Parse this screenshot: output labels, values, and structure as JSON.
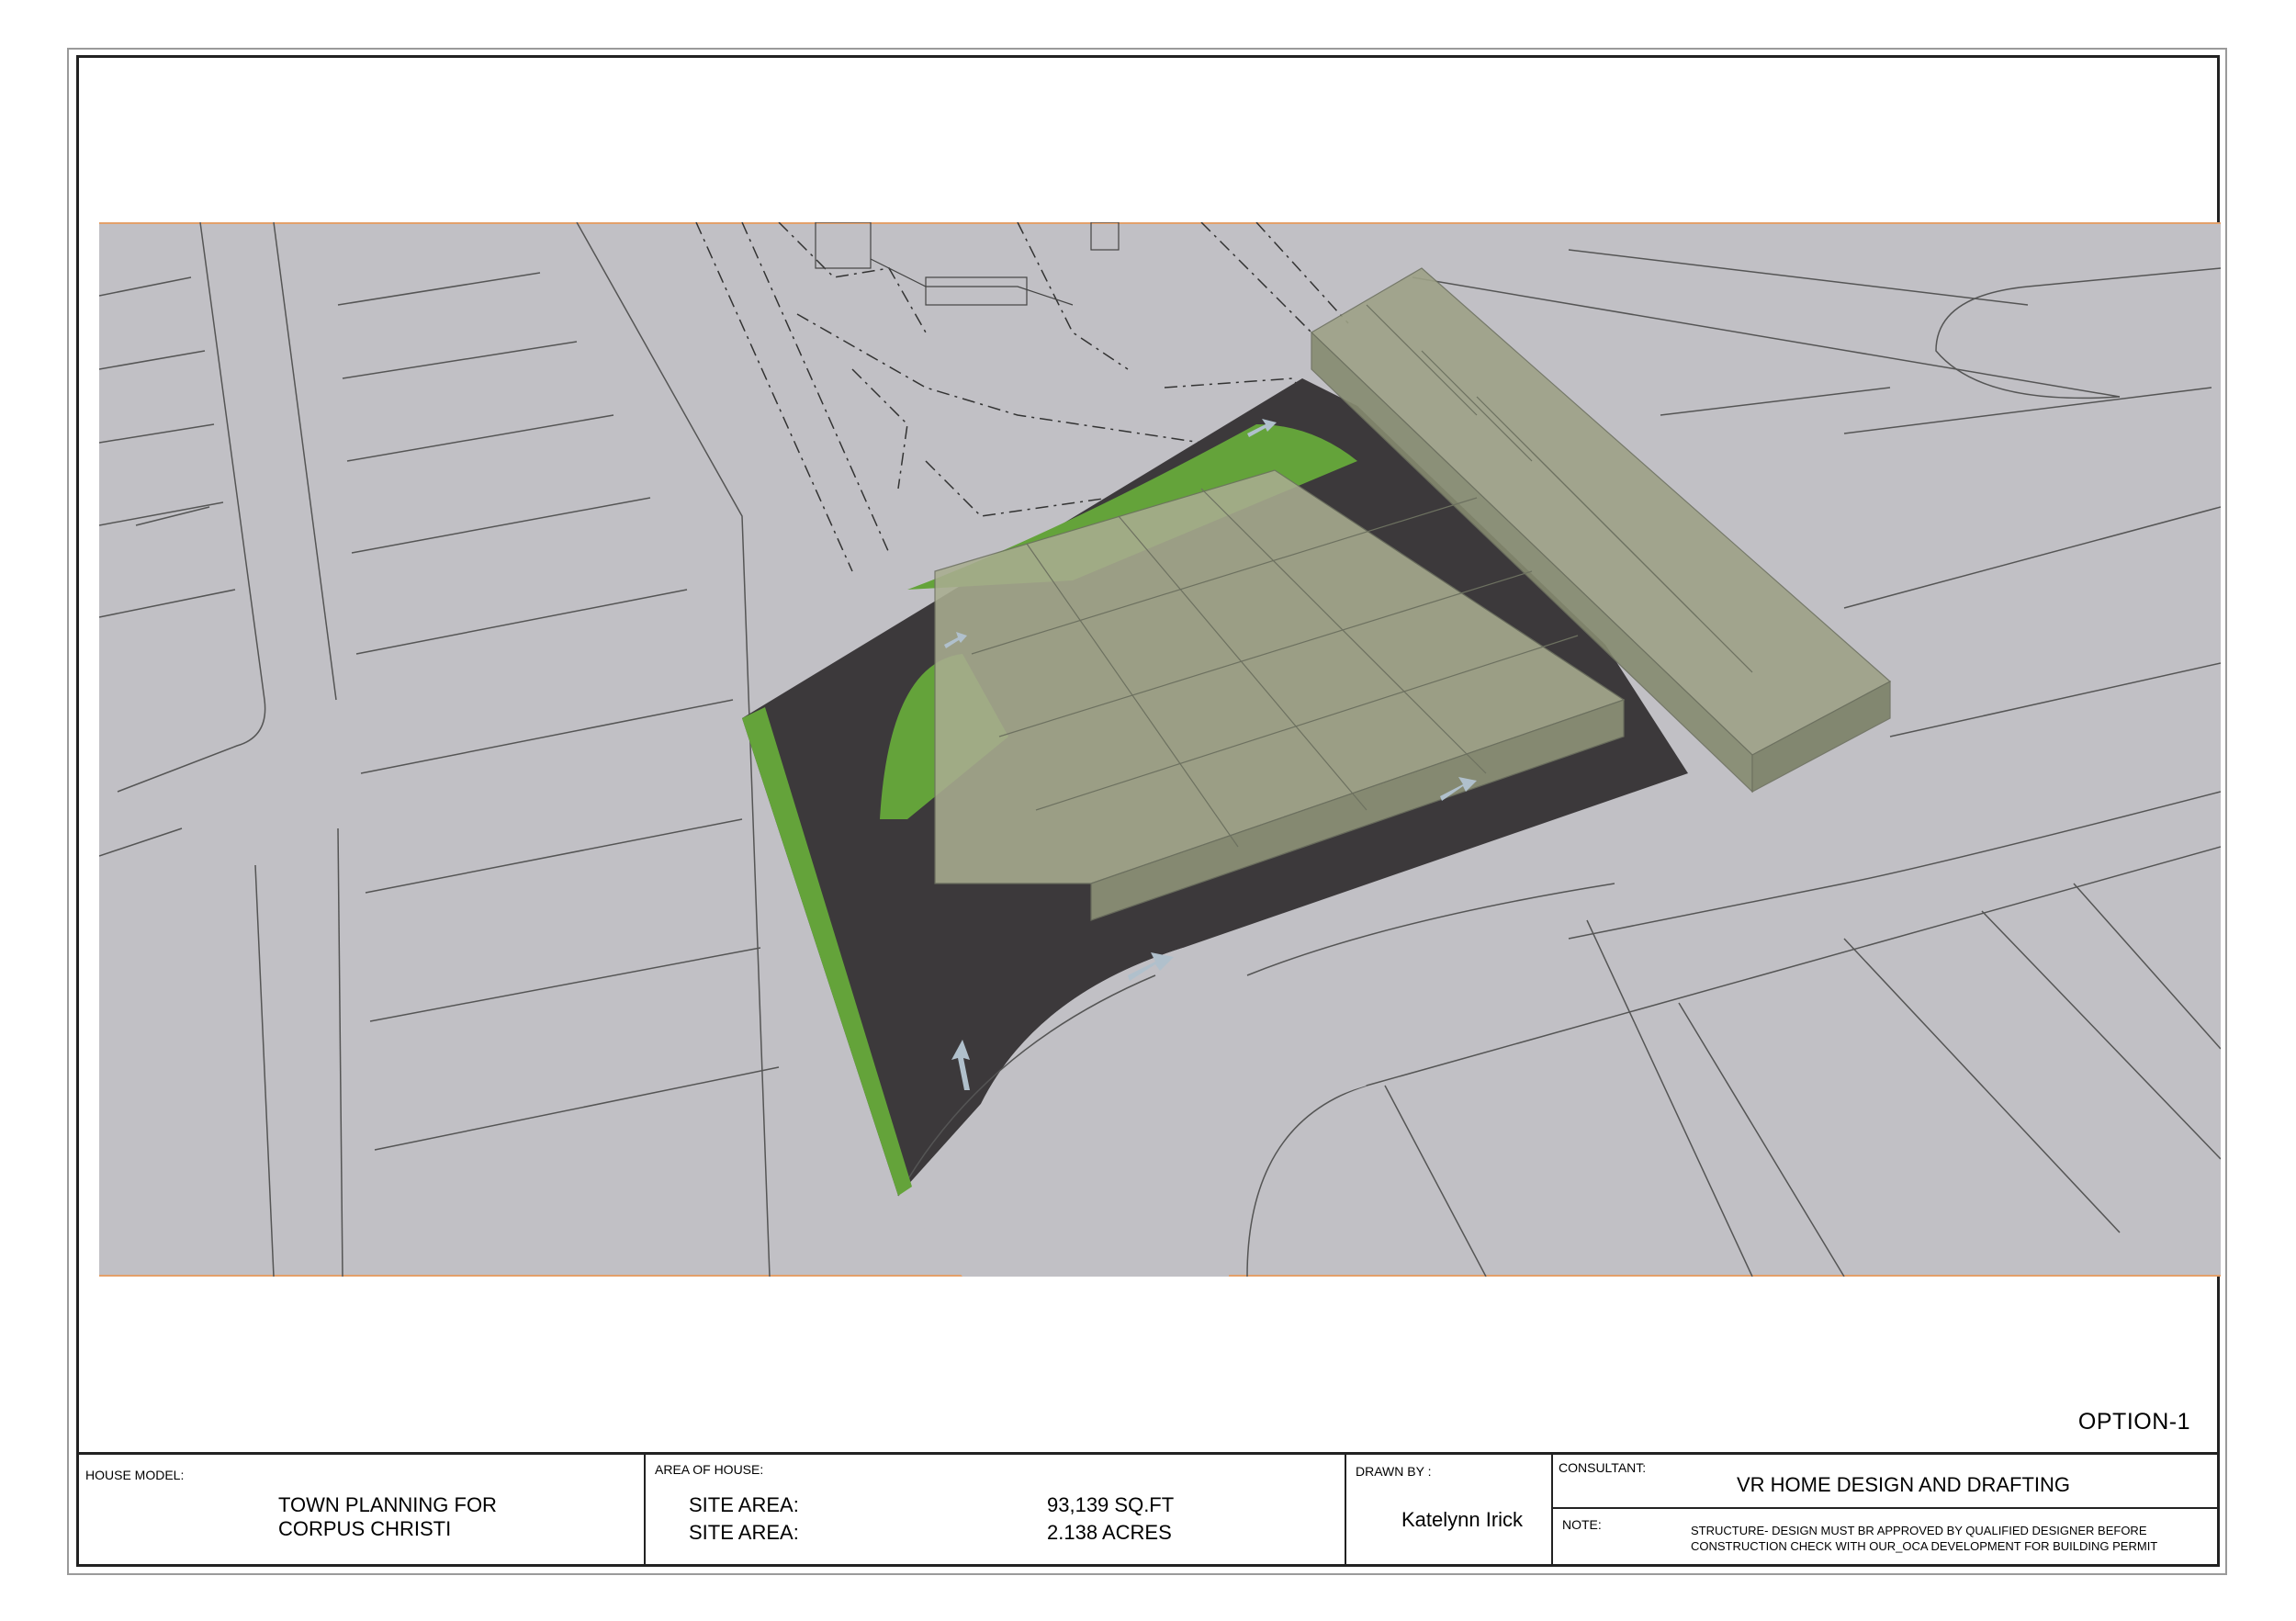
{
  "drawing": {
    "option_label": "OPTION-1"
  },
  "title_block": {
    "house_model_label": "HOUSE MODEL:",
    "house_model_line1": "TOWN PLANNING FOR",
    "house_model_line2": "CORPUS CHRISTI",
    "area_label": "AREA OF HOUSE:",
    "site_area_label_1": "SITE AREA:",
    "site_area_value_1": "93,139 SQ.FT",
    "site_area_label_2": "SITE AREA:",
    "site_area_value_2": "2.138 ACRES",
    "drawn_by_label": "DRAWN BY :",
    "drawn_by_name": "Katelynn Irick",
    "consultant_label": "CONSULTANT:",
    "consultant_name": "VR HOME DESIGN AND DRAFTING",
    "note_label": "NOTE:",
    "note_line1": "STRUCTURE- DESIGN MUST BR APPROVED BY QUALIFIED DESIGNER  BEFORE",
    "note_line2": "CONSTRUCTION CHECK WITH OUR_OCA  DEVELOPMENT FOR BUILDING PERMIT"
  },
  "colors": {
    "ground": "#c1c0c5",
    "road": "#3c393b",
    "grass": "#64a33a",
    "block_top": "#a9ad90",
    "block_side": "#959a7c"
  }
}
